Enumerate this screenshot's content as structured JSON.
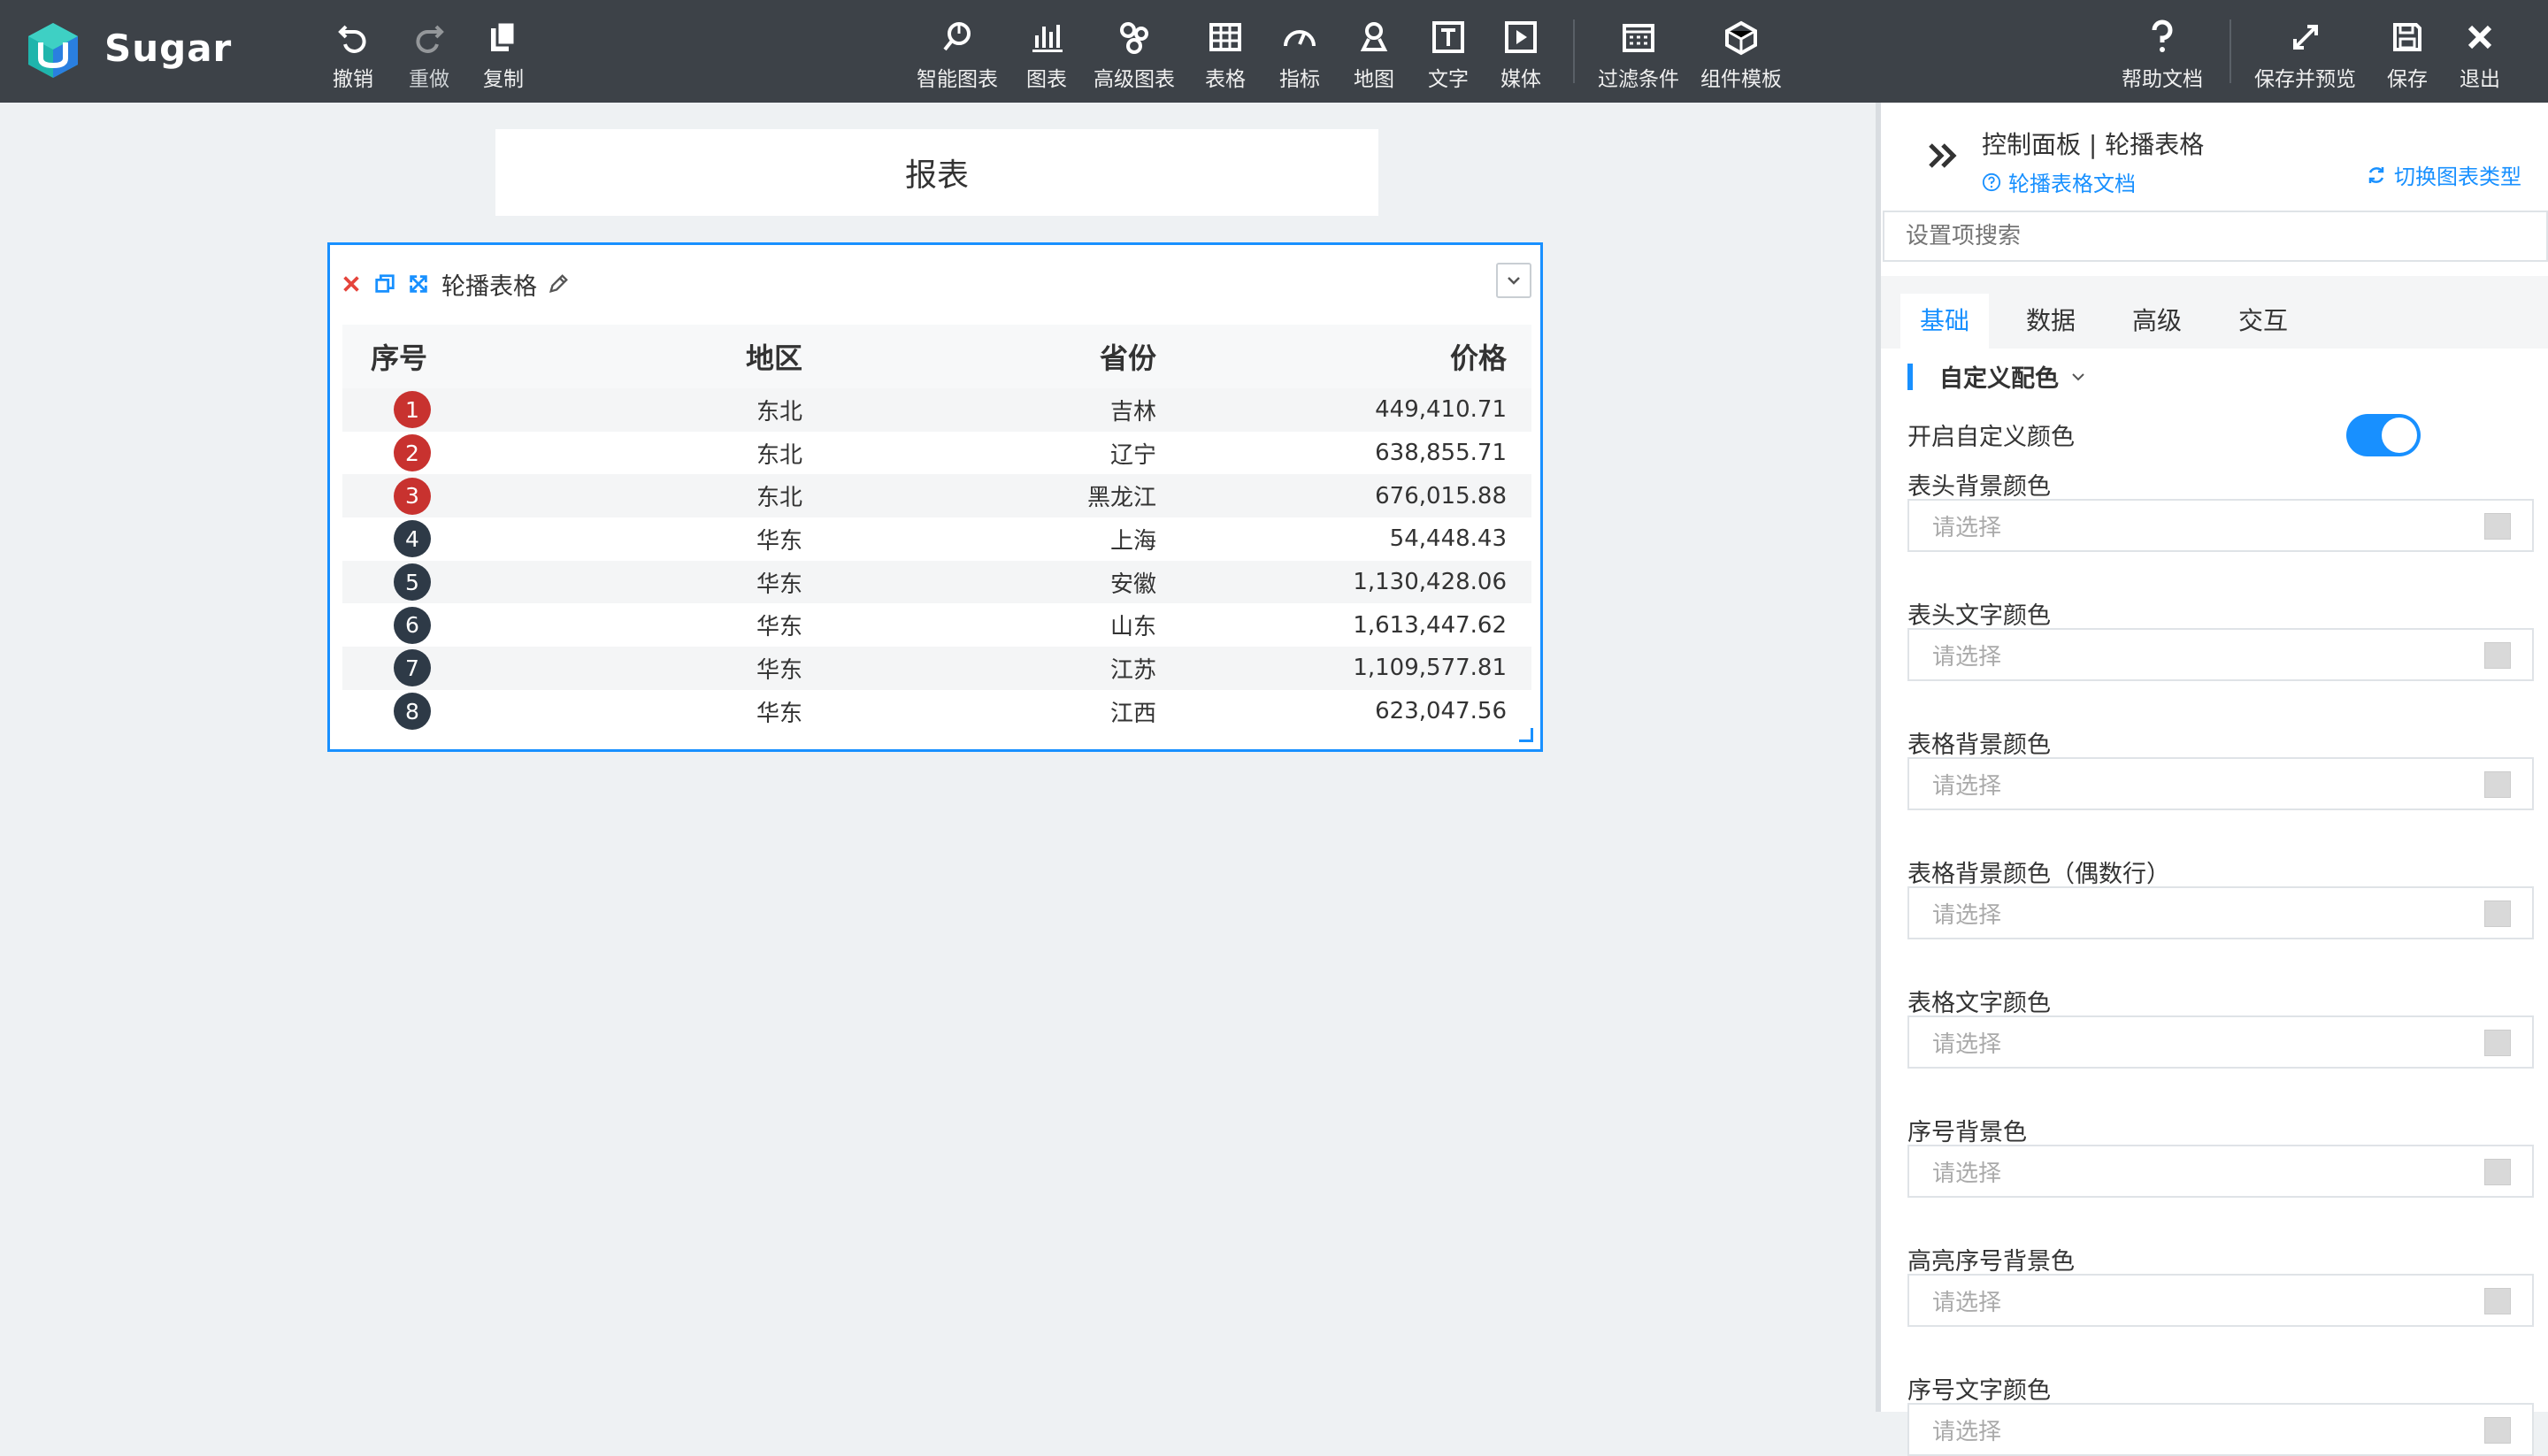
{
  "app": {
    "brand": "Sugar"
  },
  "toolbar": {
    "left": [
      {
        "label": "撤销",
        "icon": "undo-icon",
        "disabled": false
      },
      {
        "label": "重做",
        "icon": "redo-icon",
        "disabled": true
      },
      {
        "label": "复制",
        "icon": "copy-icon",
        "disabled": false
      }
    ],
    "middle": [
      {
        "label": "智能图表",
        "icon": "smart-chart-icon"
      },
      {
        "label": "图表",
        "icon": "bar-chart-icon"
      },
      {
        "label": "高级图表",
        "icon": "advanced-chart-icon"
      },
      {
        "label": "表格",
        "icon": "table-icon"
      },
      {
        "label": "指标",
        "icon": "gauge-icon"
      },
      {
        "label": "地图",
        "icon": "map-pin-icon"
      },
      {
        "label": "文字",
        "icon": "text-icon"
      },
      {
        "label": "媒体",
        "icon": "media-icon"
      },
      {
        "label": "过滤条件",
        "icon": "filter-calendar-icon"
      },
      {
        "label": "组件模板",
        "icon": "template-icon"
      }
    ],
    "right": [
      {
        "label": "帮助文档",
        "icon": "help-icon"
      },
      {
        "label": "保存并预览",
        "icon": "expand-arrows-icon"
      },
      {
        "label": "保存",
        "icon": "save-icon"
      },
      {
        "label": "退出",
        "icon": "close-icon"
      }
    ]
  },
  "canvas": {
    "report_title": "报表",
    "widget": {
      "title": "轮播表格",
      "columns": [
        "序号",
        "地区",
        "省份",
        "价格"
      ],
      "rows": [
        {
          "idx": "1",
          "region": "东北",
          "province": "吉林",
          "price": "449,410.71",
          "highlight": true
        },
        {
          "idx": "2",
          "region": "东北",
          "province": "辽宁",
          "price": "638,855.71",
          "highlight": true
        },
        {
          "idx": "3",
          "region": "东北",
          "province": "黑龙江",
          "price": "676,015.88",
          "highlight": true
        },
        {
          "idx": "4",
          "region": "华东",
          "province": "上海",
          "price": "54,448.43",
          "highlight": false
        },
        {
          "idx": "5",
          "region": "华东",
          "province": "安徽",
          "price": "1,130,428.06",
          "highlight": false
        },
        {
          "idx": "6",
          "region": "华东",
          "province": "山东",
          "price": "1,613,447.62",
          "highlight": false
        },
        {
          "idx": "7",
          "region": "华东",
          "province": "江苏",
          "price": "1,109,577.81",
          "highlight": false
        },
        {
          "idx": "8",
          "region": "华东",
          "province": "江西",
          "price": "623,047.56",
          "highlight": false
        }
      ]
    }
  },
  "panel": {
    "title": "控制面板 | 轮播表格",
    "doc_link": "轮播表格文档",
    "switch_link": "切换图表类型",
    "search_placeholder": "设置项搜索",
    "tabs": [
      "基础",
      "数据",
      "高级",
      "交互"
    ],
    "active_tab": "基础",
    "group": "自定义配色",
    "toggle_label": "开启自定义颜色",
    "toggle_on": true,
    "color_fields": [
      {
        "label": "表头背景颜色",
        "placeholder": "请选择"
      },
      {
        "label": "表头文字颜色",
        "placeholder": "请选择"
      },
      {
        "label": "表格背景颜色",
        "placeholder": "请选择"
      },
      {
        "label": "表格背景颜色（偶数行）",
        "placeholder": "请选择"
      },
      {
        "label": "表格文字颜色",
        "placeholder": "请选择"
      },
      {
        "label": "序号背景色",
        "placeholder": "请选择"
      },
      {
        "label": "高亮序号背景色",
        "placeholder": "请选择"
      },
      {
        "label": "序号文字颜色",
        "placeholder": "请选择"
      }
    ]
  },
  "colors": {
    "topbar": "#3d4248",
    "accent": "#1890ff",
    "badge_highlight": "#c8322f",
    "badge_normal": "#2e3a47",
    "canvas_bg": "#eef1f3"
  }
}
